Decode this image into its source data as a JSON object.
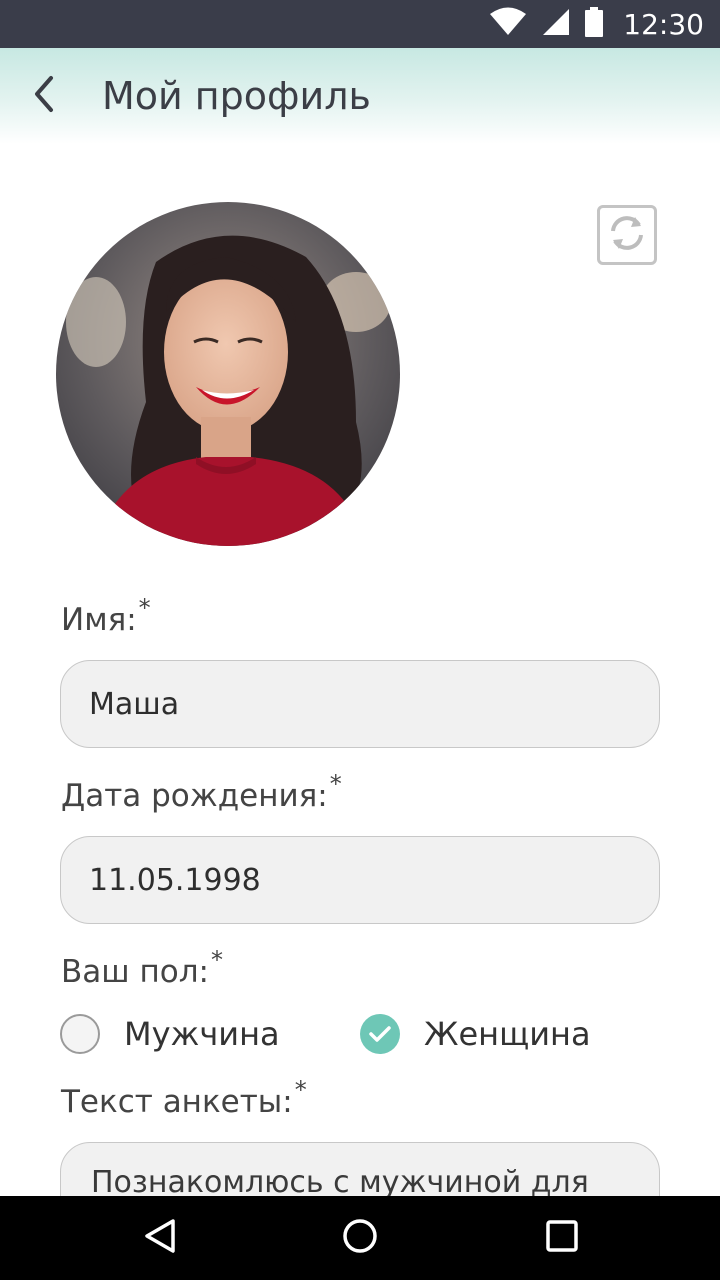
{
  "status_bar": {
    "time": "12:30",
    "icons": [
      "wifi-icon",
      "cellular-signal-icon",
      "battery-icon"
    ]
  },
  "header": {
    "title": "Мой профиль",
    "back_icon": "chevron-left-icon"
  },
  "profile": {
    "avatar": "profile-photo",
    "refresh_icon": "refresh-icon"
  },
  "form": {
    "name": {
      "label": "Имя:",
      "required_mark": "*",
      "value": "Маша"
    },
    "birth_date": {
      "label": "Дата рождения:",
      "required_mark": "*",
      "value": "11.05.1998"
    },
    "gender": {
      "label": "Ваш пол:",
      "required_mark": "*",
      "options": [
        {
          "label": "Мужчина",
          "checked": false
        },
        {
          "label": "Женщина",
          "checked": true
        }
      ]
    },
    "bio": {
      "label": "Текст анкеты:",
      "required_mark": "*",
      "value": "Познакомлюсь с мужчиной для"
    }
  },
  "colors": {
    "status_bar": "#3a3d4a",
    "header_gradient_top": "#c7e8e2",
    "accent": "#6ec7b6",
    "input_bg": "#f1f1f1"
  },
  "nav_bar": {
    "icons": [
      "back-triangle-icon",
      "home-circle-icon",
      "recents-square-icon"
    ]
  }
}
